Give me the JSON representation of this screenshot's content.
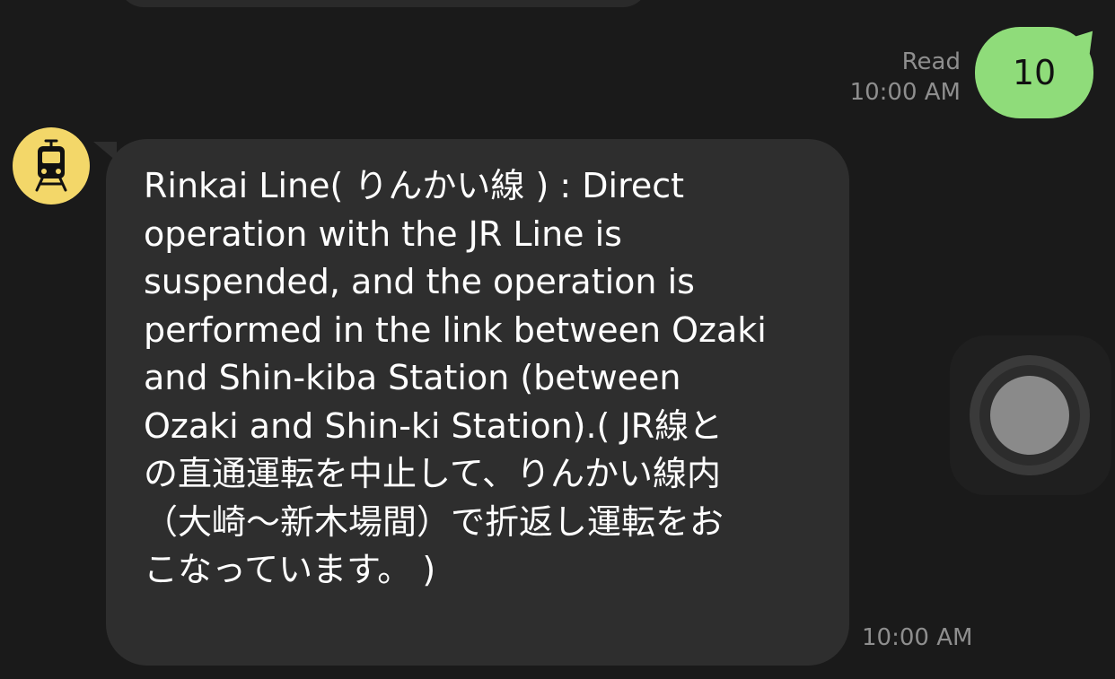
{
  "outgoing": {
    "status": "Read",
    "time": "10:00 AM",
    "text": "10"
  },
  "incoming": {
    "avatar_icon": "train-icon",
    "text": "Rinkai Line( りんかい線 ) : Direct\noperation with the JR Line is\nsuspended, and the operation is\nperformed in the link between Ozaki\nand Shin-kiba Station (between\nOzaki and Shin-ki Station).( JR線と\nの直通運転を中止して、りんかい線内\n（大崎〜新木場間）で折返し運転をお\nこなっています。 )",
    "time": "10:00 AM"
  },
  "assistive_touch": {
    "icon": "assistive-touch-icon"
  },
  "colors": {
    "background": "#1a1a1a",
    "outgoing_bubble": "#8fdc7a",
    "incoming_bubble": "#2e2e2e",
    "avatar": "#f3d769"
  }
}
